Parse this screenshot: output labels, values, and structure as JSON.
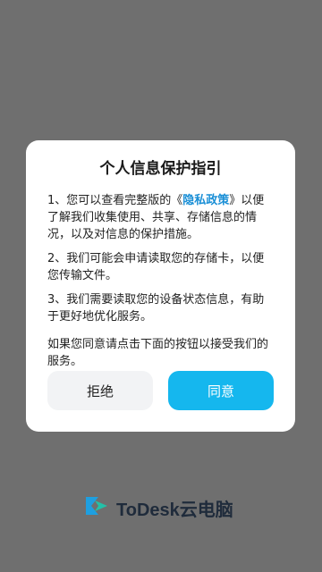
{
  "dialog": {
    "title": "个人信息保护指引",
    "p1_prefix": "1、您可以查看完整版的《",
    "p1_link": "隐私政策",
    "p1_suffix": "》以便了解我们收集使用、共享、存储信息的情况，以及对信息的保护措施。",
    "p2": "2、我们可能会申请读取您的存储卡，以便您传输文件。",
    "p3": "3、我们需要读取您的设备状态信息，有助于更好地优化服务。",
    "p4": "如果您同意请点击下面的按钮以接受我们的服务。",
    "reject_label": "拒绝",
    "agree_label": "同意"
  },
  "brand": {
    "name": "ToDesk云电脑",
    "icon": "todesk-logo-icon"
  },
  "colors": {
    "overlay": "#6f6f6f",
    "accent": "#15b7ee",
    "link": "#1a8fd6"
  }
}
